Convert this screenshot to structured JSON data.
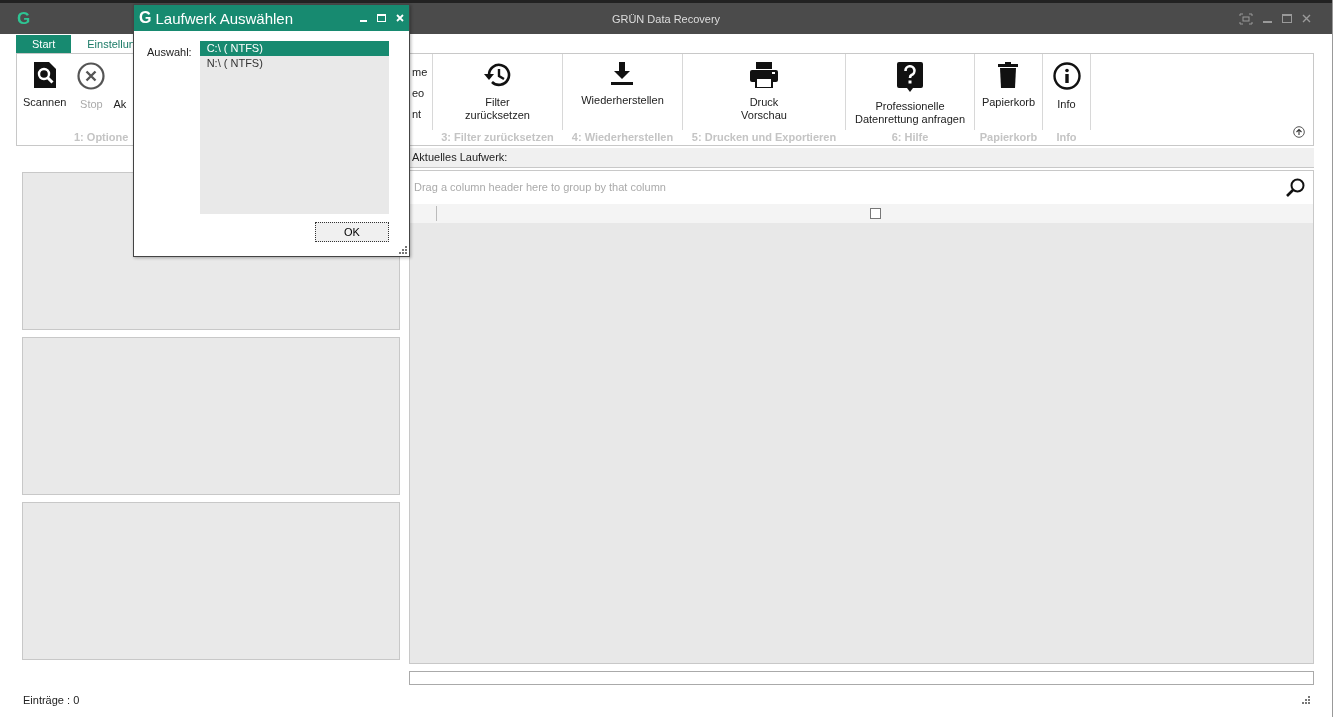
{
  "window": {
    "title": "GRÜN Data Recovery"
  },
  "tabs": [
    {
      "label": "Start",
      "selected": true
    },
    {
      "label": "Einstellun",
      "selected": false
    }
  ],
  "ribbon": {
    "groups": [
      {
        "label": "1: Optione",
        "buttons": [
          {
            "kind": "large",
            "label": "Scannen",
            "disabled": false
          },
          {
            "kind": "large",
            "label": "Stop",
            "disabled": true
          },
          {
            "kind": "text",
            "label": "Ak",
            "disabled": false
          }
        ]
      },
      {
        "buttons": [
          {
            "kind": "small",
            "label": "me"
          },
          {
            "kind": "small",
            "label": "eo"
          },
          {
            "kind": "small",
            "label": "nt"
          }
        ]
      },
      {
        "label": "3: Filter zurücksetzen",
        "buttons": [
          {
            "kind": "large",
            "label": "Filter\nzurücksetzen",
            "disabled": false
          }
        ]
      },
      {
        "label": "4: Wiederherstellen",
        "buttons": [
          {
            "kind": "large",
            "label": "Wiederherstellen",
            "disabled": false
          }
        ]
      },
      {
        "label": "5: Drucken und Exportieren",
        "buttons": [
          {
            "kind": "large",
            "label": "Druck\nVorschau",
            "disabled": false
          }
        ]
      },
      {
        "label": "6: Hilfe",
        "buttons": [
          {
            "kind": "large",
            "label": "Professionelle\nDatenrettung anfragen",
            "disabled": false
          }
        ]
      },
      {
        "label": "Papierkorb",
        "buttons": [
          {
            "kind": "large",
            "label": "Papierkorb",
            "disabled": false
          }
        ]
      },
      {
        "label": "Info",
        "buttons": [
          {
            "kind": "large",
            "label": "Info",
            "disabled": false
          }
        ]
      }
    ]
  },
  "drive_header": {
    "label": "Aktuelles Laufwerk:"
  },
  "progress": {
    "level": 0
  },
  "grid": {
    "group_panel_hint": "Drag a column header here to group by that column",
    "select_all_checked": false
  },
  "status_bar": {
    "entries": "Einträge : 0"
  },
  "dialog": {
    "title": "Laufwerk Auswählen",
    "logo": "G",
    "label": "Auswahl:",
    "drives": [
      {
        "label": "C:\\ ( NTFS)",
        "selected": true
      },
      {
        "label": "N:\\ ( NTFS)",
        "selected": false
      }
    ],
    "ok": "OK"
  },
  "app_logo": "G"
}
